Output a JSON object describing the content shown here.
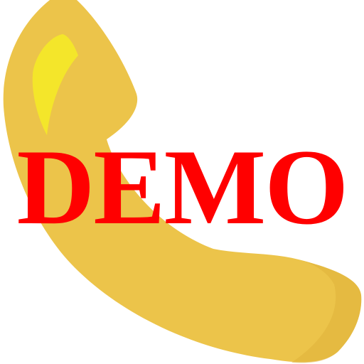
{
  "icon": {
    "name": "phone-handset-icon",
    "colors": {
      "body": "#ECC44A",
      "shade": "#E0B23A",
      "highlight": "#F4E62A"
    }
  },
  "watermark": {
    "text": "DEMO",
    "color": "#FF0000"
  }
}
